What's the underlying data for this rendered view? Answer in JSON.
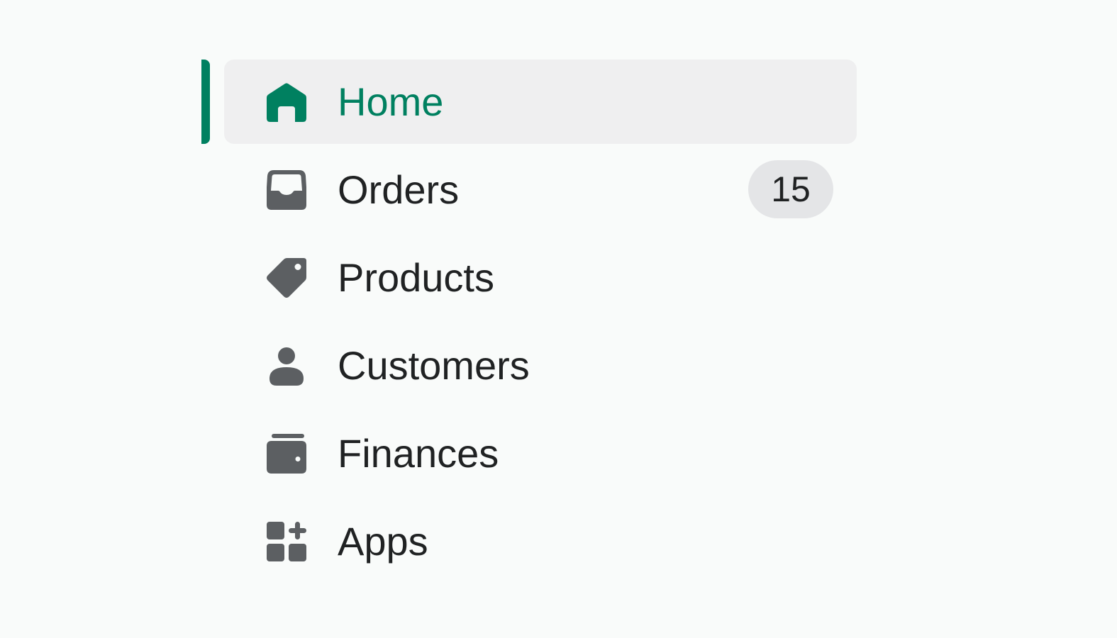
{
  "colors": {
    "accent": "#008060",
    "active_bg": "#efeff0",
    "icon": "#5c5f62",
    "text": "#202223",
    "badge_bg": "#e4e5e7"
  },
  "nav": {
    "items": [
      {
        "label": "Home",
        "icon": "home-icon",
        "active": true
      },
      {
        "label": "Orders",
        "icon": "inbox-icon",
        "badge": "15"
      },
      {
        "label": "Products",
        "icon": "tag-icon"
      },
      {
        "label": "Customers",
        "icon": "person-icon"
      },
      {
        "label": "Finances",
        "icon": "wallet-icon"
      },
      {
        "label": "Apps",
        "icon": "apps-icon"
      }
    ]
  }
}
